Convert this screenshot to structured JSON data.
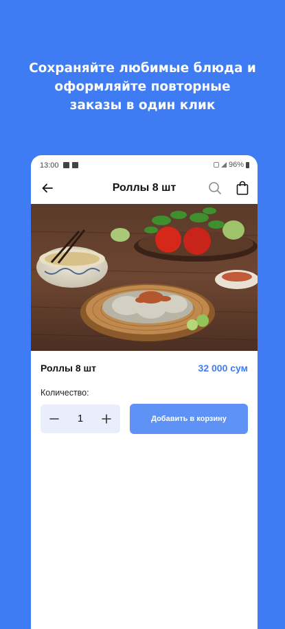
{
  "promo": {
    "line1": "Сохраняйте любимые блюда и",
    "line2": "оформляйте повторные",
    "line3": "заказы в один клик"
  },
  "status_bar": {
    "time": "13:00",
    "battery": "96%"
  },
  "app_bar": {
    "title": "Роллы 8 шт",
    "icons": [
      "back-arrow-icon",
      "search-icon",
      "shopping-bag-icon"
    ]
  },
  "product": {
    "name": "Роллы 8 шт",
    "price": "32 000 сум"
  },
  "quantity": {
    "label": "Количество:",
    "value": "1",
    "minus": "−",
    "plus": "+"
  },
  "actions": {
    "add_to_cart": "Добавить в корзину"
  },
  "colors": {
    "background": "#3f7cf4",
    "accent": "#3f7cf4",
    "button": "#5e92f5",
    "stepper_bg": "#e8eefb"
  }
}
